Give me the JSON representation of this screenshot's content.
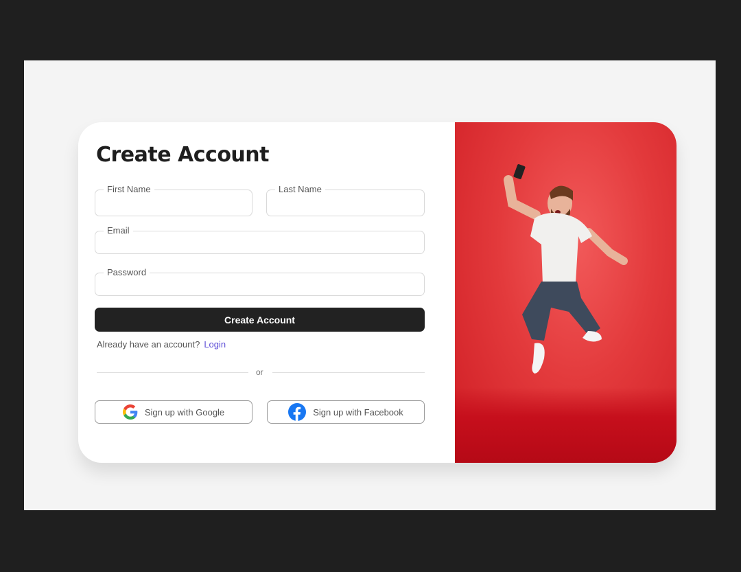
{
  "form": {
    "title": "Create Account",
    "fields": {
      "first_name": {
        "label": "First Name",
        "value": "",
        "placeholder": ""
      },
      "last_name": {
        "label": "Last Name",
        "value": "",
        "placeholder": ""
      },
      "email": {
        "label": "Email",
        "value": "",
        "placeholder": ""
      },
      "password": {
        "label": "Password",
        "value": "",
        "placeholder": ""
      }
    },
    "submit_label": "Create Account",
    "login_prompt": "Already have an account?",
    "login_link": "Login",
    "divider_text": "or",
    "google_label": "Sign up with Google",
    "facebook_label": "Sign up with Facebook"
  },
  "colors": {
    "page_bg": "#1f1f1f",
    "stage_bg": "#f4f4f4",
    "primary_button": "#222222",
    "link": "#5b4bd6",
    "facebook": "#1877f2",
    "photo_bg": "#e33a3c"
  },
  "icons": [
    "google-icon",
    "facebook-icon"
  ]
}
